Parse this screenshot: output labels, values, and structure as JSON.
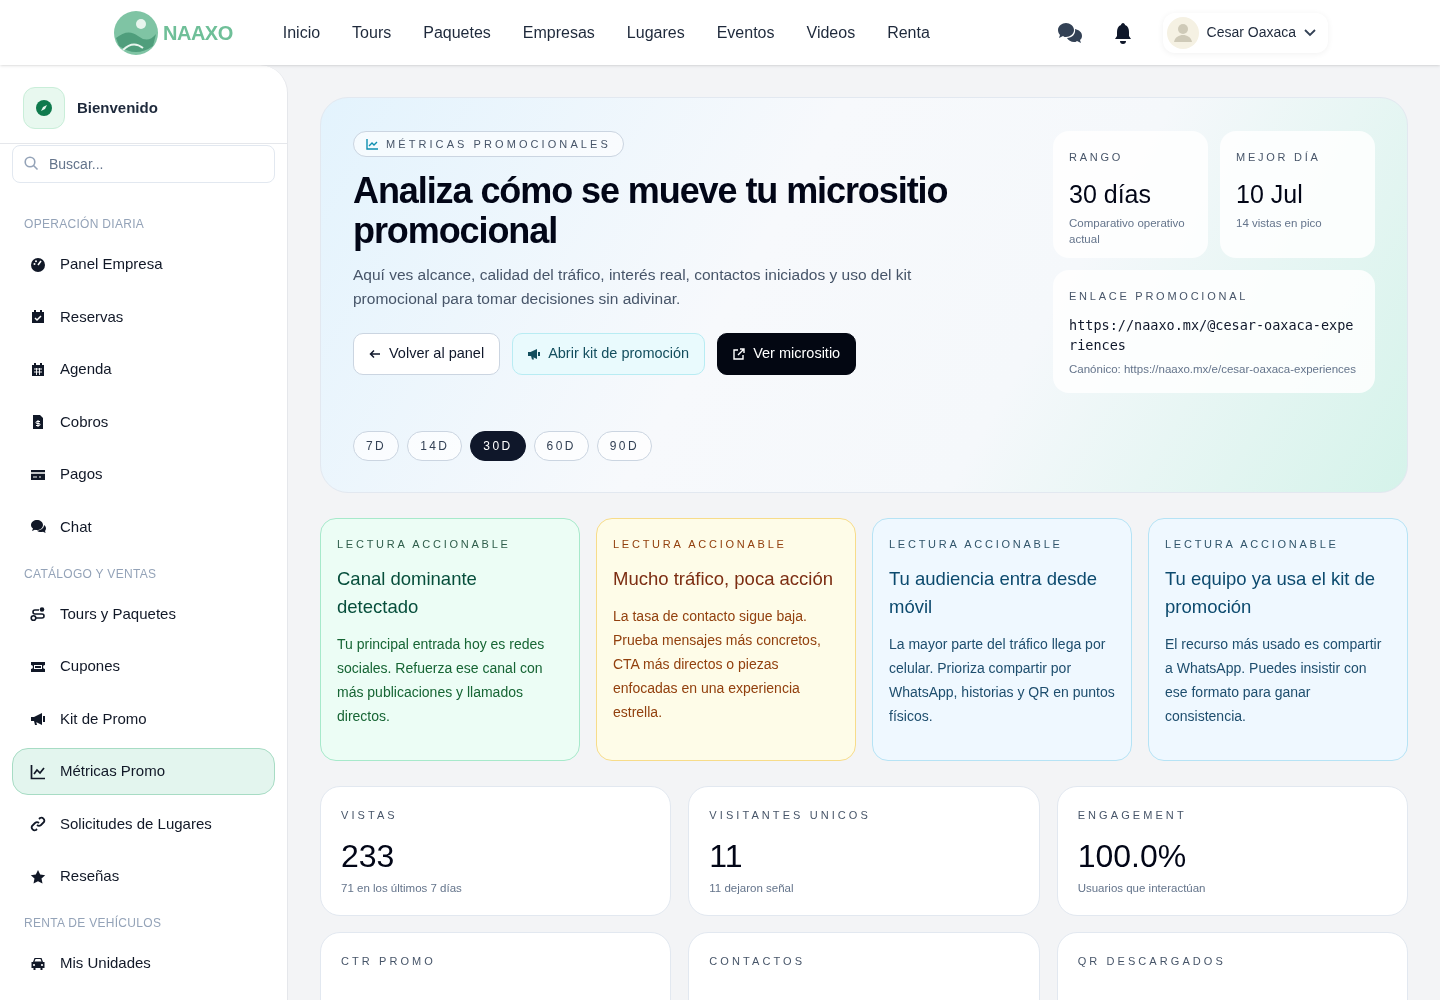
{
  "header": {
    "brand": "NAAXO",
    "nav": [
      {
        "label": "Inicio"
      },
      {
        "label": "Tours"
      },
      {
        "label": "Paquetes"
      },
      {
        "label": "Empresas"
      },
      {
        "label": "Lugares"
      },
      {
        "label": "Eventos"
      },
      {
        "label": "Videos"
      },
      {
        "label": "Renta"
      }
    ],
    "user": "Cesar Oaxaca"
  },
  "sidebar": {
    "welcome": "Bienvenido",
    "search": {
      "placeholder": "Buscar..."
    },
    "sections": [
      {
        "title": "OPERACIÓN DIARIA",
        "items": [
          {
            "label": "Panel Empresa",
            "selected": false
          },
          {
            "label": "Reservas",
            "selected": false
          },
          {
            "label": "Agenda",
            "selected": false
          },
          {
            "label": "Cobros",
            "selected": false
          },
          {
            "label": "Pagos",
            "selected": false
          },
          {
            "label": "Chat",
            "selected": false
          }
        ]
      },
      {
        "title": "CATÁLOGO Y VENTAS",
        "items": [
          {
            "label": "Tours y Paquetes",
            "selected": false
          },
          {
            "label": "Cupones",
            "selected": false
          },
          {
            "label": "Kit de Promo",
            "selected": false
          },
          {
            "label": "Métricas Promo",
            "selected": true
          },
          {
            "label": "Solicitudes de Lugares",
            "selected": false
          },
          {
            "label": "Reseñas",
            "selected": false
          }
        ]
      },
      {
        "title": "RENTA DE VEHÍCULOS",
        "items": [
          {
            "label": "Mis Unidades",
            "selected": false
          }
        ]
      }
    ]
  },
  "hero": {
    "badge": "MÉTRICAS PROMOCIONALES",
    "title": "Analiza cómo se mueve tu micrositio promocional",
    "description": "Aquí ves alcance, calidad del tráfico, interés real, contactos iniciados y uso del kit promocional para tomar decisiones sin adivinar.",
    "buttons": [
      {
        "label": "Volver al panel",
        "kind": "outline"
      },
      {
        "label": "Abrir kit de promoción",
        "kind": "soft"
      },
      {
        "label": "Ver micrositio",
        "kind": "dark"
      }
    ],
    "ranges": [
      {
        "label": "7D",
        "selected": false
      },
      {
        "label": "14D",
        "selected": false
      },
      {
        "label": "30D",
        "selected": true
      },
      {
        "label": "60D",
        "selected": false
      },
      {
        "label": "90D",
        "selected": false
      }
    ],
    "stats": [
      {
        "label": "RANGO",
        "value": "30 días",
        "note": "Comparativo operativo actual"
      },
      {
        "label": "MEJOR DÍA",
        "value": "10 Jul",
        "note": "14 vistas en pico"
      }
    ],
    "link": {
      "label": "ENLACE PROMOCIONAL",
      "url": "https://naaxo.mx/@cesar-oaxaca-experiences",
      "canonical": "Canónico: https://naaxo.mx/e/cesar-oaxaca-experiences"
    }
  },
  "insights": [
    {
      "eyebrow": "LECTURA ACCIONABLE",
      "title": "Canal dominante detectado",
      "text": "Tu principal entrada hoy es redes sociales. Refuerza ese canal con más publicaciones y llamados directos.",
      "color": "#064e3b"
    },
    {
      "eyebrow": "LECTURA ACCIONABLE",
      "title": "Mucho tráfico, poca acción",
      "text": "La tasa de contacto sigue baja. Prueba mensajes más concretos, CTA más directos o piezas enfocadas en una experiencia estrella.",
      "color": "#7c2d12"
    },
    {
      "eyebrow": "LECTURA ACCIONABLE",
      "title": "Tu audiencia entra desde móvil",
      "text": "La mayor parte del tráfico llega por celular. Prioriza compartir por WhatsApp, historias y QR en puntos físicos.",
      "color": "#0c4a6e"
    },
    {
      "eyebrow": "LECTURA ACCIONABLE",
      "title": "Tu equipo ya usa el kit de promoción",
      "text": "El recurso más usado es compartir a WhatsApp. Puedes insistir con ese formato para ganar consistencia.",
      "color": "#0c4a6e"
    }
  ],
  "metrics": [
    {
      "label": "VISTAS",
      "value": "233",
      "note": "71 en los últimos 7 días"
    },
    {
      "label": "VISITANTES UNICOS",
      "value": "11",
      "note": "11 dejaron señal"
    },
    {
      "label": "ENGAGEMENT",
      "value": "100.0%",
      "note": "Usuarios que interactúan"
    },
    {
      "label": "CTR PROMO"
    },
    {
      "label": "CONTACTOS"
    },
    {
      "label": "QR DESCARGADOS"
    }
  ]
}
